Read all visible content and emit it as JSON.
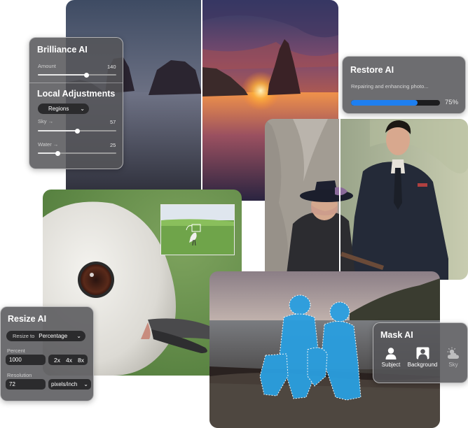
{
  "brilliance": {
    "title": "Brilliance AI",
    "amount_label": "Amount",
    "amount_value": "140",
    "amount_level": 0.62
  },
  "local": {
    "title": "Local Adjustments",
    "regions_label": "Regions",
    "sky_label": "Sky →",
    "sky_value": "57",
    "sky_level": 0.5,
    "water_label": "Water →",
    "water_value": "25",
    "water_level": 0.25
  },
  "restore": {
    "title": "Restore AI",
    "status": "Repairing and enhancing photo...",
    "progress_text": "75%",
    "progress": 0.75,
    "accent": "#1e7ff0"
  },
  "resize": {
    "title": "Resize AI",
    "resize_to_label": "Resize to",
    "resize_to_value": "Percentage",
    "percent_label": "Percent",
    "percent_value": "1000",
    "multipliers": [
      "2x",
      "4x",
      "8x"
    ],
    "resolution_label": "Resolution",
    "resolution_value": "72",
    "unit_value": "pixels/inch"
  },
  "mask": {
    "title": "Mask AI",
    "options": [
      {
        "label": "Subject",
        "icon": "person-icon"
      },
      {
        "label": "Background",
        "icon": "background-icon"
      },
      {
        "label": "Sky",
        "icon": "sky-cloud-icon"
      }
    ],
    "mask_color": "#2a9fe0"
  }
}
